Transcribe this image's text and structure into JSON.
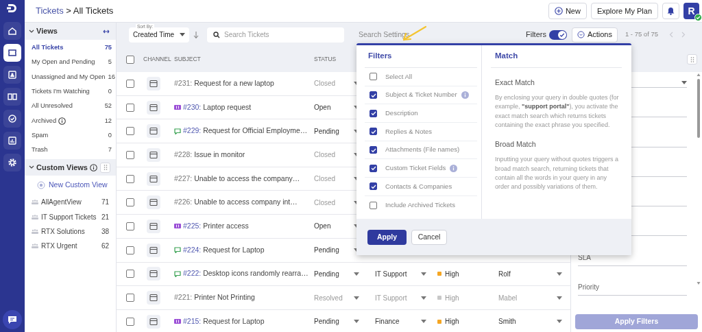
{
  "rail": {
    "items": [
      {
        "kind": "home",
        "selected": false
      },
      {
        "kind": "tickets",
        "selected": true
      },
      {
        "kind": "contacts",
        "selected": false
      },
      {
        "kind": "knowledge",
        "selected": false
      },
      {
        "kind": "tasks",
        "selected": false
      },
      {
        "kind": "reports",
        "selected": false
      },
      {
        "kind": "settings",
        "selected": false
      }
    ]
  },
  "header": {
    "breadcrumb": {
      "parent": "Tickets",
      "separator": ">",
      "current": "All Tickets"
    },
    "new_button": "New",
    "plan_button": "Explore My Plan",
    "avatar": {
      "initial": "R",
      "online": true
    }
  },
  "sidebar": {
    "views": {
      "title": "Views",
      "items": [
        {
          "label": "All Tickets",
          "count": "75",
          "selected": true,
          "info": false
        },
        {
          "label": "My Open and Pending",
          "count": "5",
          "selected": false,
          "info": false
        },
        {
          "label": "Unassigned and My Open",
          "count": "16",
          "selected": false,
          "info": false
        },
        {
          "label": "Tickets I'm Watching",
          "count": "0",
          "selected": false,
          "info": false
        },
        {
          "label": "All Unresolved",
          "count": "52",
          "selected": false,
          "info": false
        },
        {
          "label": "Archived",
          "count": "12",
          "selected": false,
          "info": true
        },
        {
          "label": "Spam",
          "count": "0",
          "selected": false,
          "info": false
        },
        {
          "label": "Trash",
          "count": "7",
          "selected": false,
          "info": false
        }
      ]
    },
    "custom_views": {
      "title": "Custom Views",
      "new_label": "New Custom View",
      "items": [
        {
          "label": "AllAgentView",
          "count": "71"
        },
        {
          "label": "IT Support Tickets",
          "count": "21"
        },
        {
          "label": "RTX Solutions",
          "count": "38"
        },
        {
          "label": "RTX Urgent",
          "count": "62"
        }
      ]
    }
  },
  "toolbar": {
    "sort": {
      "label": "Sort By:",
      "value": "Created Time"
    },
    "search": {
      "placeholder": "Search Tickets"
    },
    "search_settings": "Search Settings",
    "filters": {
      "label": "Filters",
      "on": true
    },
    "actions": "Actions",
    "pagination": "1 - 75 of 75"
  },
  "table": {
    "select_all_checked": false,
    "columns": [
      "CHANNEL",
      "SUBJECT",
      "STATUS"
    ],
    "rows": [
      {
        "checked": false,
        "kind": "none",
        "number": "#231:",
        "subject": "Request for a new laptop",
        "status": "Closed",
        "greyed": true
      },
      {
        "checked": false,
        "kind": "ticket",
        "number": "#230:",
        "subject": "Laptop request",
        "status": "Open",
        "greyed": false
      },
      {
        "checked": false,
        "kind": "chat",
        "number": "#229:",
        "subject": "Request for Official Employme…",
        "status": "Pending",
        "greyed": false
      },
      {
        "checked": false,
        "kind": "none",
        "number": "#228:",
        "subject": "Issue in monitor",
        "status": "Closed",
        "greyed": true
      },
      {
        "checked": false,
        "kind": "none",
        "number": "#227:",
        "subject": "Unable to access the company…",
        "status": "Closed",
        "greyed": true
      },
      {
        "checked": false,
        "kind": "none",
        "number": "#226:",
        "subject": "Unable to access company int…",
        "status": "Closed",
        "greyed": true
      },
      {
        "checked": false,
        "kind": "ticket",
        "number": "#225:",
        "subject": "Printer access",
        "status": "Open",
        "greyed": false
      },
      {
        "checked": false,
        "kind": "chat",
        "number": "#224:",
        "subject": "Request for Laptop",
        "status": "Pending",
        "greyed": false
      },
      {
        "checked": false,
        "kind": "chat",
        "number": "#222:",
        "subject": "Desktop icons randomly rearra…",
        "status": "Pending",
        "greyed": false,
        "group": "IT Support",
        "priority": "High",
        "color": "#f5a623",
        "agent": "Rolf"
      },
      {
        "checked": false,
        "kind": "none",
        "number": "#221:",
        "subject": "Printer Not Printing",
        "status": "Resolved",
        "greyed": true,
        "group": "IT Support",
        "priority": "High",
        "color": "#c8c8c8",
        "agent": "Mabel"
      },
      {
        "checked": false,
        "kind": "ticket",
        "number": "#215:",
        "subject": "Request for Laptop",
        "status": "Pending",
        "greyed": false,
        "group": "Finance",
        "priority": "High",
        "color": "#f5a623",
        "agent": "Smith"
      }
    ]
  },
  "filter_panel": {
    "fields": [
      {
        "kind": "select"
      },
      {
        "kind": "text"
      },
      {
        "kind": "text"
      },
      {
        "kind": "text"
      },
      {
        "kind": "text"
      },
      {
        "kind": "text"
      },
      {
        "kind": "text",
        "label": "SLA"
      },
      {
        "kind": "text",
        "label": "Priority"
      }
    ],
    "apply": "Apply Filters"
  },
  "search_settings_popup": {
    "filters_title": "Filters",
    "filters": [
      {
        "label": "Select All",
        "checked": false,
        "info": false
      },
      {
        "label": "Subject & Ticket Number",
        "checked": true,
        "info": true
      },
      {
        "label": "Description",
        "checked": true,
        "info": false
      },
      {
        "label": "Replies & Notes",
        "checked": true,
        "info": false
      },
      {
        "label": "Attachments (File names)",
        "checked": true,
        "info": false
      },
      {
        "label": "Custom Ticket Fields",
        "checked": true,
        "info": true
      },
      {
        "label": "Contacts & Companies",
        "checked": true,
        "info": false
      },
      {
        "label": "Include Archived Tickets",
        "checked": false,
        "info": false
      }
    ],
    "match_title": "Match",
    "sections": [
      {
        "title": "Exact Match",
        "text": "By enclosing your query in double quotes (for example, **\"support portal\"**), you activate the exact match search which returns tickets containing the exact phrase you specified."
      },
      {
        "title": "Broad Match",
        "text": "Inputting your query without quotes triggers a broad match search, returning tickets that contain all the words in your query in any order and possibly variations of them."
      }
    ],
    "apply": "Apply",
    "cancel": "Cancel"
  }
}
